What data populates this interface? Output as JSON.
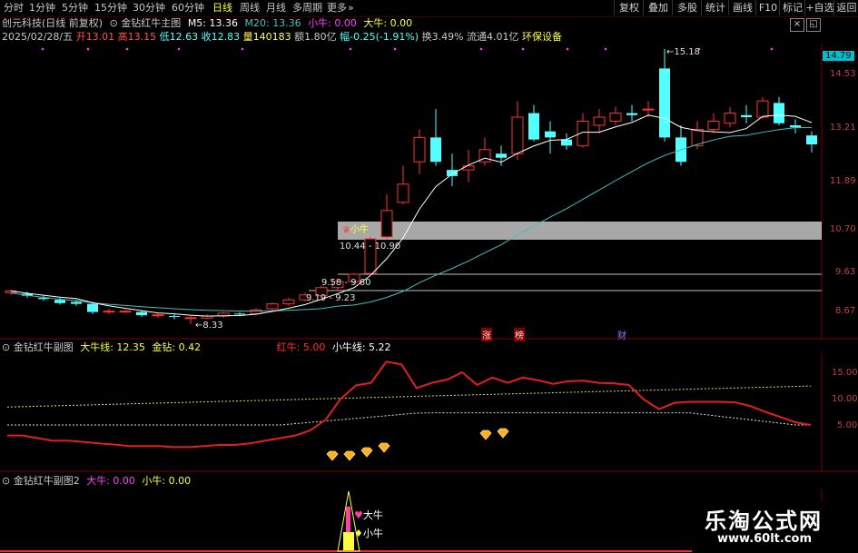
{
  "toolbar": {
    "tabs": [
      "分时",
      "1分钟",
      "5分钟",
      "15分钟",
      "30分钟",
      "60分钟",
      "日线",
      "周线",
      "月线",
      "多周期",
      "更多"
    ],
    "active_tab": "日线",
    "right_buttons": [
      "复权",
      "叠加",
      "多股",
      "统计",
      "画线",
      "F10",
      "标记",
      "+自选",
      "返回"
    ]
  },
  "main": {
    "stock_title": "创元科技(日线 前复权)",
    "indicator_name": "金钻红牛主图",
    "ma5": "M5: 13.36",
    "ma20": "M20: 13.36",
    "xiaoniu": "小牛: 0.00",
    "daniu": "大牛: 0.00",
    "date": "2025/02/28/五",
    "open": "开13.01",
    "high": "高13.15",
    "low": "低12.63",
    "close": "收12.83",
    "volume": "量140183",
    "amount": "额1.80亿",
    "change": "幅-0.25(-1.91%)",
    "turnover": "换3.49%",
    "float_cap": "流通4.01亿",
    "sector": "环保设备",
    "price_labels": [
      "14.53",
      "13.21",
      "11.89",
      "10.70",
      "9.63",
      "8.67"
    ],
    "current_price": "14.79",
    "high_mark": "15.18",
    "low_mark": "8.33",
    "zone1": "10.44 - 10.90",
    "zone2": "9.58 - 9.60",
    "zone3": "9.19 - 9.23",
    "signal_label": "小牛",
    "markers": [
      "涨",
      "榜",
      "财"
    ]
  },
  "sub1": {
    "name": "金钻红牛副图",
    "daniu_line": "大牛线: 12.35",
    "jinzuan": "金钻: 0.42",
    "hongniu": "红牛: 5.00",
    "xiaoniu_line": "小牛线: 5.22",
    "axis": [
      "15.00",
      "10.00",
      "5.00"
    ]
  },
  "sub2": {
    "name": "金钻红牛副图2",
    "daniu": "大牛: 0.00",
    "xiaoniu": "小牛: 0.00",
    "label_da": "大牛",
    "label_xiao": "小牛"
  },
  "watermark": {
    "title": "乐淘公式网",
    "url": "www.60lt.com"
  },
  "colors": {
    "up": "#ff3232",
    "down": "#54ffff",
    "ma5": "#ffffff",
    "ma20": "#40c0c0",
    "hongniu": "#e02020",
    "yellow": "#ffff40"
  }
}
